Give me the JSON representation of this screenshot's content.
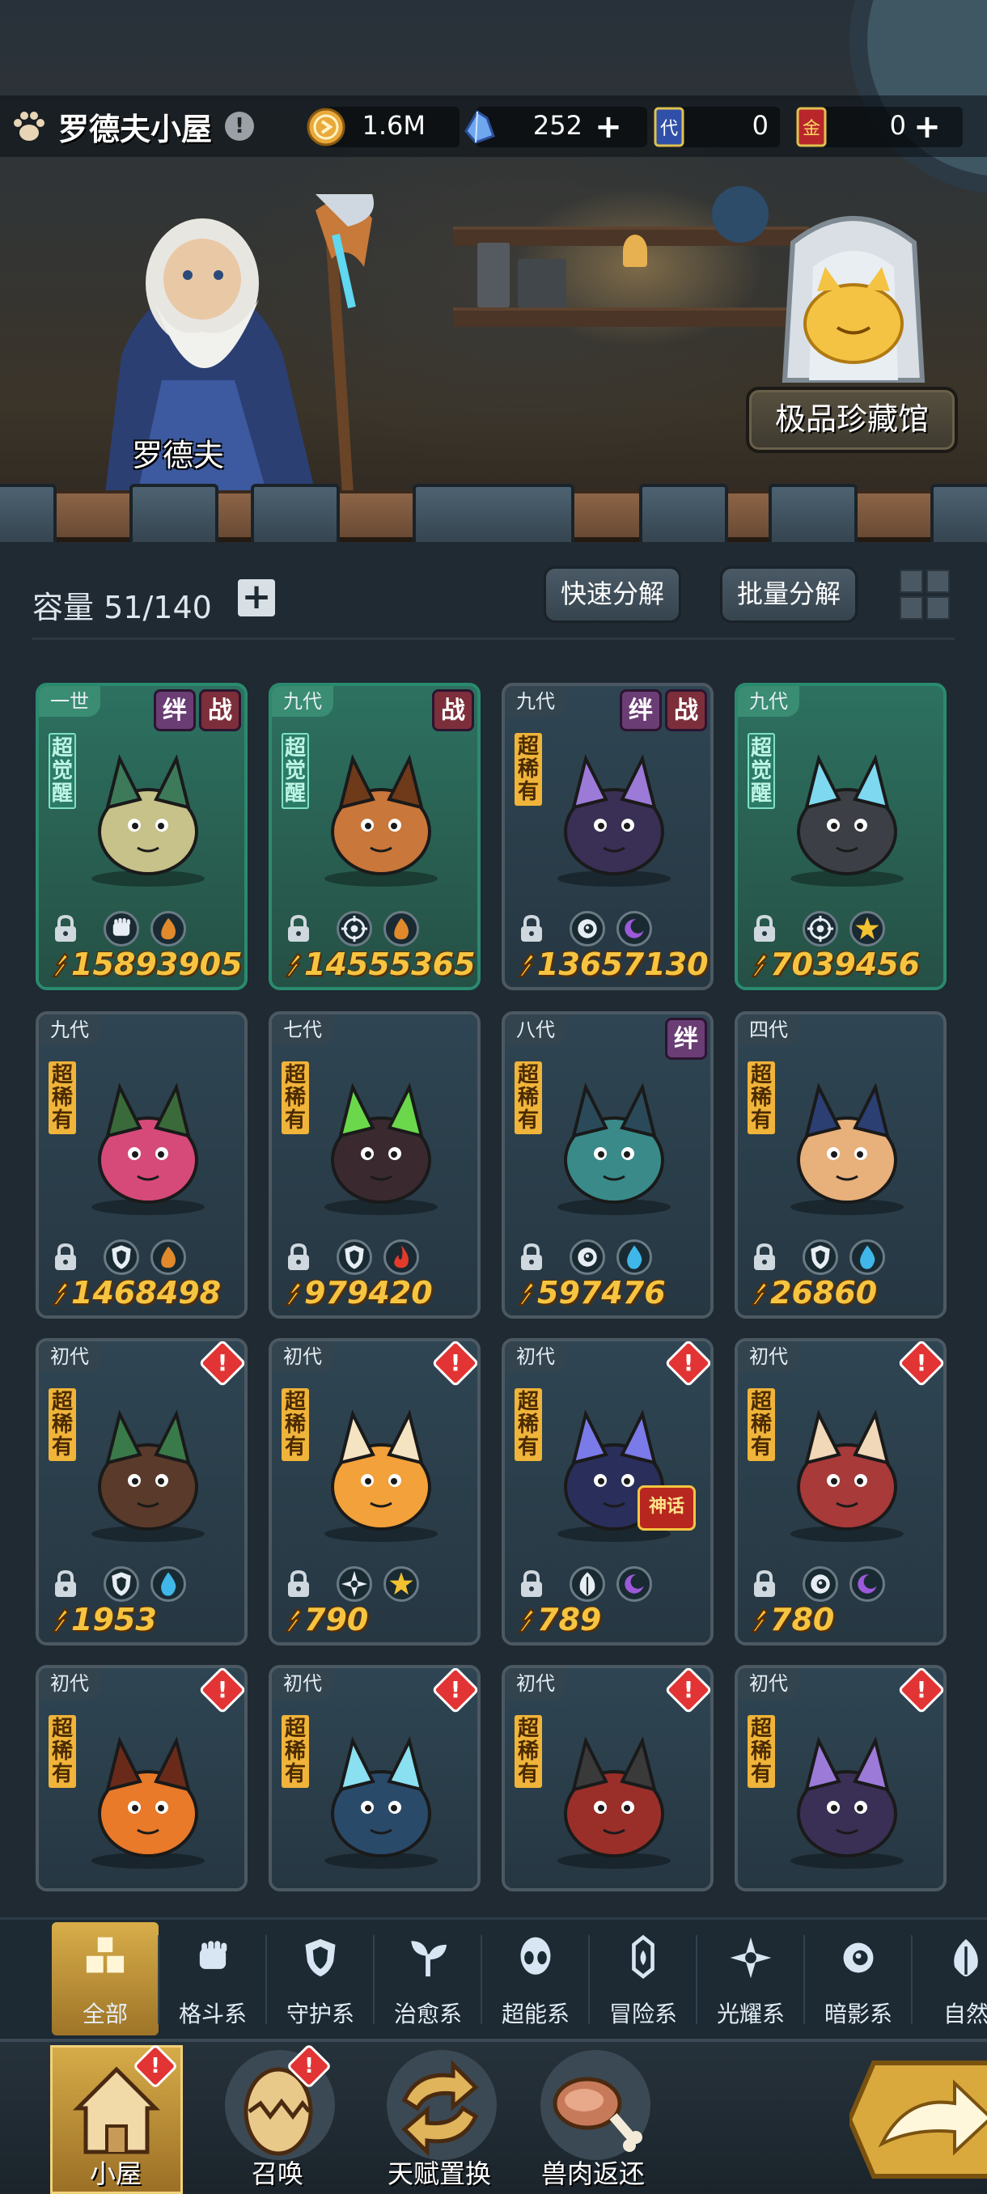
{
  "header": {
    "title": "罗德夫小屋",
    "currencies": [
      {
        "icon": "gold-coin-icon",
        "value": "1.6M"
      },
      {
        "icon": "crystal-icon",
        "value": "252"
      },
      {
        "icon": "generation-card-icon",
        "value": "0"
      },
      {
        "icon": "gold-card-icon",
        "value": "0"
      }
    ],
    "card_icon_labels": [
      "代",
      "金"
    ]
  },
  "scene": {
    "npc_name": "罗德夫",
    "collection_button": "极品珍藏馆"
  },
  "storage": {
    "capacity_label": "容量",
    "capacity_value": "51/140",
    "quick_decompose": "快速分解",
    "batch_decompose": "批量分解"
  },
  "cards": [
    {
      "generation": "一世",
      "rank": "超觉醒",
      "awakened": true,
      "badges": [
        "绊",
        "战"
      ],
      "power": "15893905",
      "types": [
        "fist-icon",
        "flame-icon"
      ],
      "alert": false
    },
    {
      "generation": "九代",
      "rank": "超觉醒",
      "awakened": true,
      "badges": [
        "战"
      ],
      "power": "14555365",
      "types": [
        "target-icon",
        "flame-icon"
      ],
      "alert": false
    },
    {
      "generation": "九代",
      "rank": "超稀有",
      "awakened": false,
      "badges": [
        "绊",
        "战"
      ],
      "power": "13657130",
      "types": [
        "eye-icon",
        "moon-icon"
      ],
      "alert": false
    },
    {
      "generation": "九代",
      "rank": "超觉醒",
      "awakened": true,
      "badges": [],
      "power": "7039456",
      "types": [
        "target-icon",
        "star-icon"
      ],
      "alert": false
    },
    {
      "generation": "九代",
      "rank": "超稀有",
      "awakened": false,
      "badges": [],
      "power": "1468498",
      "types": [
        "shield-icon",
        "flame-icon"
      ],
      "alert": false
    },
    {
      "generation": "七代",
      "rank": "超稀有",
      "awakened": false,
      "badges": [],
      "power": "979420",
      "types": [
        "shield-icon",
        "fire-icon"
      ],
      "alert": false
    },
    {
      "generation": "八代",
      "rank": "超稀有",
      "awakened": false,
      "badges": [
        "绊"
      ],
      "power": "597476",
      "types": [
        "eye-icon",
        "water-icon"
      ],
      "alert": false
    },
    {
      "generation": "四代",
      "rank": "超稀有",
      "awakened": false,
      "badges": [],
      "power": "26860",
      "types": [
        "shield-icon",
        "water-icon"
      ],
      "alert": false
    },
    {
      "generation": "初代",
      "rank": "超稀有",
      "awakened": false,
      "badges": [],
      "power": "1953",
      "types": [
        "shield-icon",
        "water-icon"
      ],
      "alert": true
    },
    {
      "generation": "初代",
      "rank": "超稀有",
      "awakened": false,
      "badges": [],
      "power": "790",
      "types": [
        "compass-icon",
        "star-icon"
      ],
      "alert": true
    },
    {
      "generation": "初代",
      "rank": "超稀有",
      "awakened": false,
      "badges": [],
      "power": "789",
      "types": [
        "leaf-icon",
        "moon-icon"
      ],
      "alert": true,
      "myth": "神话"
    },
    {
      "generation": "初代",
      "rank": "超稀有",
      "awakened": false,
      "badges": [],
      "power": "780",
      "types": [
        "eye-icon",
        "moon-icon"
      ],
      "alert": true
    },
    {
      "generation": "初代",
      "rank": "超稀有",
      "awakened": false,
      "badges": [],
      "power": "",
      "types": [],
      "alert": true
    },
    {
      "generation": "初代",
      "rank": "超稀有",
      "awakened": false,
      "badges": [],
      "power": "",
      "types": [],
      "alert": true
    },
    {
      "generation": "初代",
      "rank": "超稀有",
      "awakened": false,
      "badges": [],
      "power": "",
      "types": [],
      "alert": true
    },
    {
      "generation": "初代",
      "rank": "超稀有",
      "awakened": false,
      "badges": [],
      "power": "",
      "types": [],
      "alert": true
    }
  ],
  "alert_mark": "!",
  "categories": [
    {
      "label": "全部",
      "icon": "all-icon",
      "active": true
    },
    {
      "label": "格斗系",
      "icon": "fist-icon",
      "active": false
    },
    {
      "label": "守护系",
      "icon": "shield-icon",
      "active": false
    },
    {
      "label": "治愈系",
      "icon": "sprout-icon",
      "active": false
    },
    {
      "label": "超能系",
      "icon": "alien-icon",
      "active": false
    },
    {
      "label": "冒险系",
      "icon": "lantern-icon",
      "active": false
    },
    {
      "label": "光耀系",
      "icon": "compass-icon",
      "active": false
    },
    {
      "label": "暗影系",
      "icon": "eye-icon",
      "active": false
    },
    {
      "label": "自然",
      "icon": "leaf-icon",
      "active": false
    }
  ],
  "nav": [
    {
      "label": "小屋",
      "icon": "house-icon",
      "active": true,
      "alert": true
    },
    {
      "label": "召唤",
      "icon": "egg-icon",
      "active": false,
      "alert": true
    },
    {
      "label": "天赋置换",
      "icon": "swap-icon",
      "active": false,
      "alert": false
    },
    {
      "label": "兽肉返还",
      "icon": "meat-icon",
      "active": false,
      "alert": false
    }
  ],
  "colors": {
    "power_text": "#f5c542",
    "accent_gold": "#d6ab48",
    "alert_red": "#e23434",
    "awakened_green": "#2b8a6e"
  }
}
